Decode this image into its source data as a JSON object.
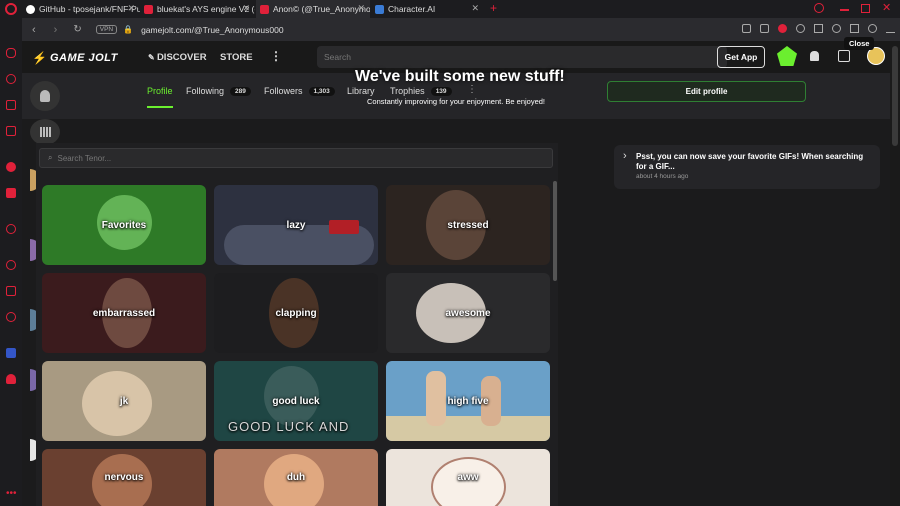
{
  "browser": {
    "tabs": [
      {
        "label": "GitHub - tposejank/FNF-Pu",
        "color": "#ffffff"
      },
      {
        "label": "bluekat's AYS engine V2 (-",
        "color": "#e0213a"
      },
      {
        "label": "Anon© (@True_Anonymous",
        "color": "#e0213a"
      },
      {
        "label": "Character.AI",
        "color": "#3a7bd5"
      }
    ],
    "new_tab": "+",
    "vpn_badge": "VPN",
    "url": "gamejolt.com/@True_Anonymous000"
  },
  "gamejolt": {
    "logo": "GAME JOLT",
    "nav": {
      "discover": "DISCOVER",
      "store": "STORE",
      "more": "⋮"
    },
    "search_placeholder": "Search",
    "get_app": "Get App",
    "close_label": "Close"
  },
  "profile": {
    "tabs": {
      "profile": "Profile",
      "following": "Following",
      "following_count": "289",
      "followers": "Followers",
      "followers_count": "1,303",
      "library": "Library",
      "trophies": "Trophies",
      "trophies_count": "139"
    },
    "banner_title": "We've built some new stuff!",
    "banner_subtitle": "Constantly improving for your enjoyment. Be enjoyed!",
    "edit_profile": "Edit profile"
  },
  "gif_picker": {
    "search_placeholder": "Search Tenor...",
    "categories": [
      "Favorites",
      "lazy",
      "stressed",
      "embarrassed",
      "clapping",
      "awesome",
      "jk",
      "good luck",
      "high five",
      "nervous",
      "duh",
      "aww"
    ],
    "overlay_text": "GOOD LUCK AND"
  },
  "notification": {
    "text": "Psst, you can now save your favorite GIFs! When searching for a GIF...",
    "time": "about 4 hours ago"
  },
  "colors": {
    "accent": "#2f7f33",
    "brand_green": "#6bef2f",
    "opera_red": "#e0213a"
  }
}
